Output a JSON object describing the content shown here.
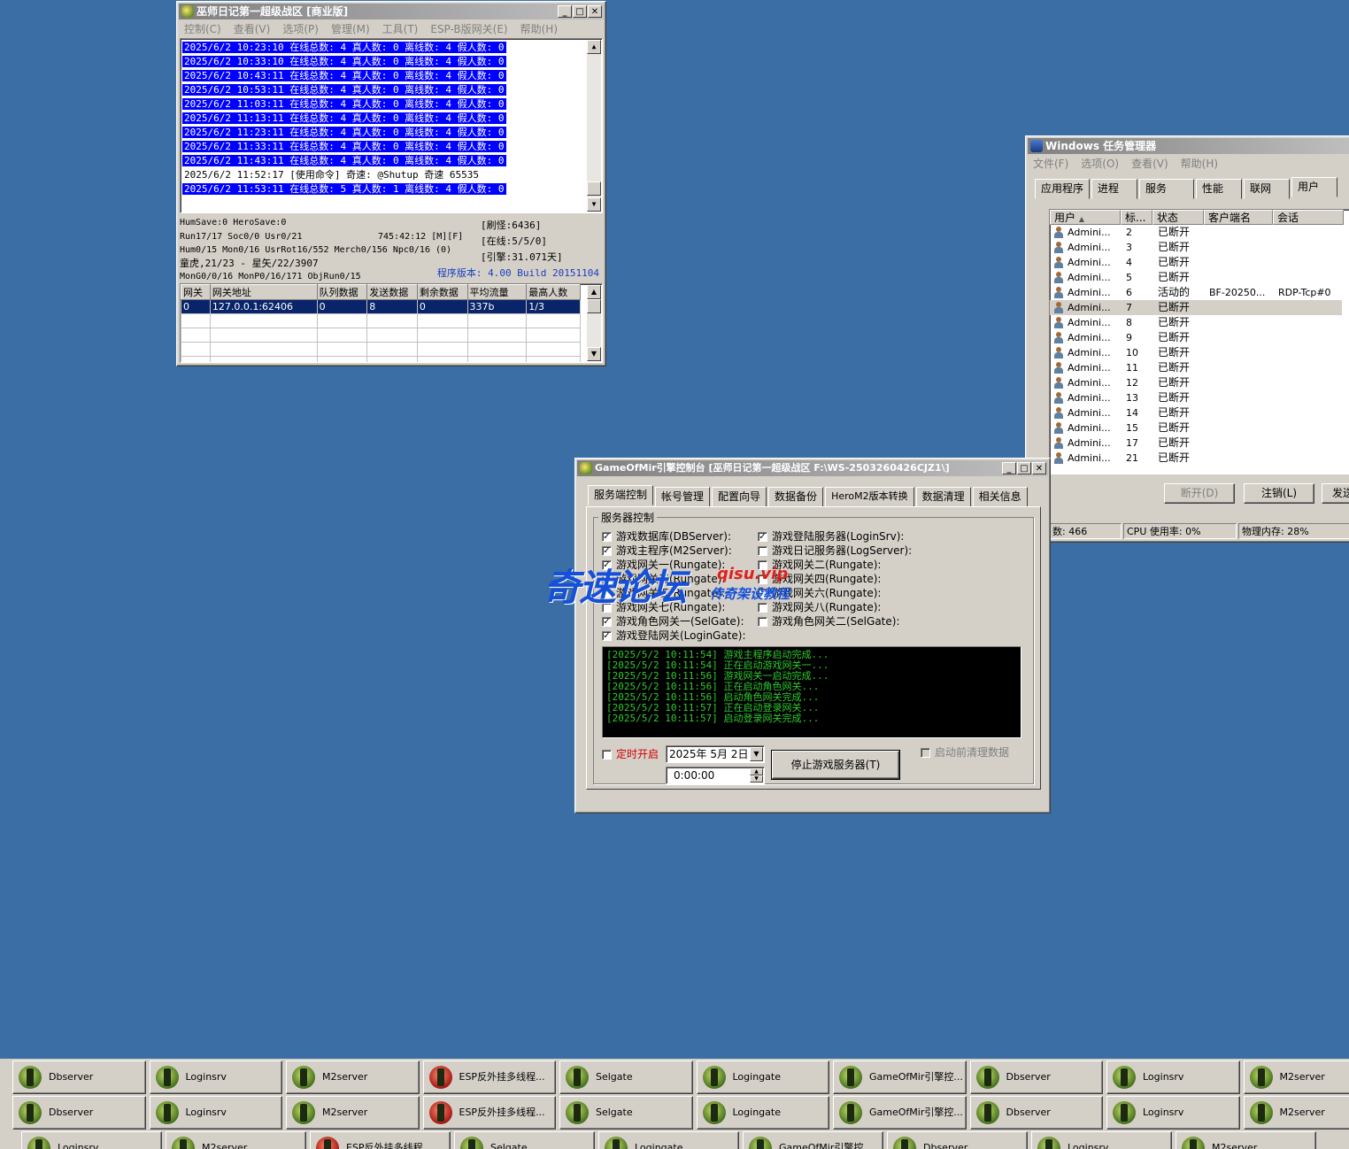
{
  "m2": {
    "title": "巫师日记第一超级战区 [商业版]",
    "menu": [
      "控制(C)",
      "查看(V)",
      "选项(P)",
      "管理(M)",
      "工具(T)",
      "ESP-B版网关(E)",
      "帮助(H)"
    ],
    "log": [
      {
        "text": "2025/6/2 10:23:10 在线总数: 4 真人数: 0 离线数: 4 假人数: 0",
        "selected": true
      },
      {
        "text": "2025/6/2 10:33:10 在线总数: 4 真人数: 0 离线数: 4 假人数: 0",
        "selected": true
      },
      {
        "text": "2025/6/2 10:43:11 在线总数: 4 真人数: 0 离线数: 4 假人数: 0",
        "selected": true
      },
      {
        "text": "2025/6/2 10:53:11 在线总数: 4 真人数: 0 离线数: 4 假人数: 0",
        "selected": true
      },
      {
        "text": "2025/6/2 11:03:11 在线总数: 4 真人数: 0 离线数: 4 假人数: 0",
        "selected": true
      },
      {
        "text": "2025/6/2 11:13:11 在线总数: 4 真人数: 0 离线数: 4 假人数: 0",
        "selected": true
      },
      {
        "text": "2025/6/2 11:23:11 在线总数: 4 真人数: 0 离线数: 4 假人数: 0",
        "selected": true
      },
      {
        "text": "2025/6/2 11:33:11 在线总数: 4 真人数: 0 离线数: 4 假人数: 0",
        "selected": true
      },
      {
        "text": "2025/6/2 11:43:11 在线总数: 4 真人数: 0 离线数: 4 假人数: 0",
        "selected": true
      },
      {
        "text": "2025/6/2 11:52:17 [使用命令] 奇速: @Shutup 奇速 65535",
        "selected": false
      },
      {
        "text": "2025/6/2 11:53:11 在线总数: 5 真人数: 1 离线数: 4 假人数: 0",
        "selected": true
      }
    ],
    "stats": {
      "line1": "HumSave:0 HeroSave:0",
      "line2": "Run17/17 Soc0/0 Usr0/21",
      "uptime": "745:42:12 [M][F]",
      "line3": "Hum0/15 Mon0/16 UsrRot16/552 Merch0/156 Npc0/16 (0)",
      "line4": "童虎,21/23 - 星矢/22/3907",
      "line5": "MonG0/0/16 MonP0/16/171 ObjRun0/15",
      "refresh": "[刷怪:6436]",
      "online": "[在线:5/5/0]",
      "engine": "[引擎:31.071天]",
      "version": "程序版本: 4.00 Build 20151104"
    },
    "gate_headers": [
      "网关",
      "网关地址",
      "队列数据",
      "发送数据",
      "剩余数据",
      "平均流量",
      "最高人数"
    ],
    "gate_rows": [
      [
        "0",
        "127.0.0.1:62406",
        "0",
        "8",
        "0",
        "337b",
        "1/3"
      ]
    ]
  },
  "taskmgr": {
    "title": "Windows 任务管理器",
    "menu": [
      "文件(F)",
      "选项(O)",
      "查看(V)",
      "帮助(H)"
    ],
    "tabs": [
      "应用程序",
      "进程",
      "服务",
      "性能",
      "联网",
      "用户"
    ],
    "headers": [
      "用户",
      "标...",
      "状态",
      "客户端名",
      "会话"
    ],
    "rows": [
      {
        "user": "Admini...",
        "id": "2",
        "status": "已断开",
        "client": "",
        "session": ""
      },
      {
        "user": "Admini...",
        "id": "3",
        "status": "已断开",
        "client": "",
        "session": ""
      },
      {
        "user": "Admini...",
        "id": "4",
        "status": "已断开",
        "client": "",
        "session": ""
      },
      {
        "user": "Admini...",
        "id": "5",
        "status": "已断开",
        "client": "",
        "session": ""
      },
      {
        "user": "Admini...",
        "id": "6",
        "status": "活动的",
        "client": "BF-20250...",
        "session": "RDP-Tcp#0"
      },
      {
        "user": "Admini...",
        "id": "7",
        "status": "已断开",
        "client": "",
        "session": ""
      },
      {
        "user": "Admini...",
        "id": "8",
        "status": "已断开",
        "client": "",
        "session": ""
      },
      {
        "user": "Admini...",
        "id": "9",
        "status": "已断开",
        "client": "",
        "session": ""
      },
      {
        "user": "Admini...",
        "id": "10",
        "status": "已断开",
        "client": "",
        "session": ""
      },
      {
        "user": "Admini...",
        "id": "11",
        "status": "已断开",
        "client": "",
        "session": ""
      },
      {
        "user": "Admini...",
        "id": "12",
        "status": "已断开",
        "client": "",
        "session": ""
      },
      {
        "user": "Admini...",
        "id": "13",
        "status": "已断开",
        "client": "",
        "session": ""
      },
      {
        "user": "Admini...",
        "id": "14",
        "status": "已断开",
        "client": "",
        "session": ""
      },
      {
        "user": "Admini...",
        "id": "15",
        "status": "已断开",
        "client": "",
        "session": ""
      },
      {
        "user": "Admini...",
        "id": "17",
        "status": "已断开",
        "client": "",
        "session": ""
      },
      {
        "user": "Admini...",
        "id": "21",
        "status": "已断开",
        "client": "",
        "session": ""
      }
    ],
    "buttons": {
      "disconnect": "断开(D)",
      "logoff": "注销(L)",
      "send": "发送消"
    },
    "status": {
      "processes": "数: 466",
      "cpu": "CPU 使用率: 0%",
      "memory": "物理内存: 28%"
    }
  },
  "ctrl": {
    "title": "GameOfMir引擎控制台 [巫师日记第一超级战区 F:\\WS-2503260426CJZ1\\]",
    "tabs": [
      "服务端控制",
      "帐号管理",
      "配置向导",
      "数据备份",
      "HeroM2版本转换",
      "数据清理",
      "相关信息"
    ],
    "group_label": "服务器控制",
    "left_checks": [
      {
        "label": "游戏数据库(DBServer):",
        "checked": true
      },
      {
        "label": "游戏主程序(M2Server):",
        "checked": true
      },
      {
        "label": "游戏网关一(Rungate):",
        "checked": true
      },
      {
        "label": "游戏网关三(Rungate):",
        "checked": false
      },
      {
        "label": "游戏网关五(Rungate):",
        "checked": false
      },
      {
        "label": "游戏网关七(Rungate):",
        "checked": false
      },
      {
        "label": "游戏角色网关一(SelGate):",
        "checked": true
      },
      {
        "label": "游戏登陆网关(LoginGate):",
        "checked": true
      }
    ],
    "right_checks": [
      {
        "label": "游戏登陆服务器(LoginSrv):",
        "checked": true
      },
      {
        "label": "游戏日记服务器(LogServer):",
        "checked": false
      },
      {
        "label": "游戏网关二(Rungate):",
        "checked": false
      },
      {
        "label": "游戏网关四(Rungate):",
        "checked": false
      },
      {
        "label": "游戏网关六(Rungate):",
        "checked": false
      },
      {
        "label": "游戏网关八(Rungate):",
        "checked": false
      },
      {
        "label": "游戏角色网关二(SelGate):",
        "checked": false
      }
    ],
    "console": [
      "[2025/5/2 10:11:54] 游戏主程序启动完成...",
      "[2025/5/2 10:11:54] 正在启动游戏网关一...",
      "[2025/5/2 10:11:56] 游戏网关一启动完成...",
      "[2025/5/2 10:11:56] 正在启动角色网关...",
      "[2025/5/2 10:11:56] 启动角色网关完成...",
      "[2025/5/2 10:11:57] 正在启动登录网关...",
      "[2025/5/2 10:11:57] 启动登录网关完成..."
    ],
    "timer_label": "定时开启",
    "date_value": "2025年 5月 2日",
    "time_value": "0:00:00",
    "stop_button": "停止游戏服务器(T)",
    "clean_label": "启动前清理数据"
  },
  "watermark": {
    "main": "奇速论坛",
    "domain": "qisu.vip",
    "sub": "传奇架设教程"
  },
  "taskbar": {
    "row1": [
      "Dbserver",
      "Loginsrv",
      "M2server",
      "ESP反外挂多线程...",
      "Selgate",
      "Logingate",
      "GameOfMir引擎控...",
      "Dbserver",
      "Loginsrv",
      "M2server"
    ],
    "row2": [
      "Dbserver",
      "Loginsrv",
      "M2server",
      "ESP反外挂多线程...",
      "Selgate",
      "Logingate",
      "GameOfMir引擎控...",
      "Dbserver",
      "Loginsrv",
      "M2server"
    ],
    "row3": [
      "Loginsrv",
      "M2server",
      "ESP反外挂多线程",
      "Selgate",
      "Logingate",
      "GameOfMir引擎控",
      "Dbserver",
      "Loginsrv",
      "M2server"
    ]
  }
}
